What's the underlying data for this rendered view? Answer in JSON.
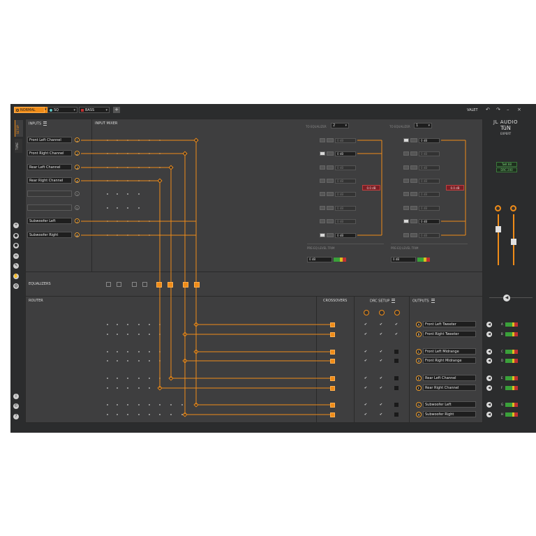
{
  "toolbar": {
    "preset1": "NORMAL",
    "preset2": "SQ",
    "preset3": "BASS",
    "add_icon": "plus-icon",
    "valet": "VALET",
    "undo_icon": "undo-icon",
    "redo_icon": "redo-icon",
    "minimize_icon": "minimize-icon",
    "close_icon": "close-icon"
  },
  "colors": {
    "accent": "#f08c18",
    "panel": "#3e3e3f",
    "bg": "#2b2c2d",
    "red": "#7a1f25"
  },
  "sidebar": {
    "tabs": [
      "SETUP",
      "TUNE"
    ],
    "icons": [
      "plus-circle-icon",
      "user-icon",
      "user-alt-icon",
      "link-icon",
      "wrench-icon",
      "hand-icon",
      "globe-icon"
    ],
    "bottom_icons": [
      "info-icon",
      "copyright-icon",
      "help-icon"
    ]
  },
  "inputs": {
    "title": "INPUTS",
    "items": [
      {
        "label": "Front Left Channel",
        "num": "1"
      },
      {
        "label": "Front Right Channel",
        "num": "2"
      },
      {
        "label": "Rear Left Channel",
        "num": "3"
      },
      {
        "label": "Rear Right Channel",
        "num": "4"
      },
      {
        "label": "",
        "num": "5"
      },
      {
        "label": "",
        "num": "6"
      },
      {
        "label": "Subwoofer Left",
        "num": "7"
      },
      {
        "label": "Subwoofer Right",
        "num": "8"
      }
    ]
  },
  "mixer": {
    "title": "INPUT MIXER",
    "to_eq_label": "TO EQUALIZER",
    "eq1_select": "2",
    "eq2_select": "1",
    "col1_values": [
      "0 dB",
      "0 dB",
      "0 dB",
      "0 dB",
      "0 dB",
      "0 dB",
      "0 dB",
      "0 dB"
    ],
    "col2_values": [
      "0 dB",
      "0 dB",
      "0 dB",
      "0 dB",
      "0 dB",
      "0 dB",
      "0 dB",
      "0 dB"
    ],
    "sum1": "0.0 dB",
    "sum2": "0.0 dB",
    "trim1_label": "PRE-EQ LEVEL TRIM",
    "trim2_label": "PRE-EQ LEVEL TRIM",
    "trim1_value": "0 dB",
    "trim2_value": "0 dB"
  },
  "equalizers": {
    "title": "EQUALIZERS"
  },
  "router": {
    "title": "ROUTER"
  },
  "crossovers": {
    "title": "CROSSOVERS"
  },
  "drc": {
    "title": "DRC SETUP"
  },
  "outputs": {
    "title": "OUTPUTS",
    "items": [
      {
        "letter": "A",
        "label": "Front Left Tweeter"
      },
      {
        "letter": "B",
        "label": "Front Right Tweeter"
      },
      {
        "letter": "C",
        "label": "Front Left Midrange"
      },
      {
        "letter": "D",
        "label": "Front Right Midrange"
      },
      {
        "letter": "E",
        "label": "Rear Left Channel"
      },
      {
        "letter": "F",
        "label": "Rear Right Channel"
      },
      {
        "letter": "G",
        "label": "Subwoofer Left"
      },
      {
        "letter": "H",
        "label": "Subwoofer Right"
      }
    ]
  },
  "brand": {
    "line1": "JL AUDIO",
    "line2": "TüN",
    "line3": "EXPERT",
    "badge1": "TwK 88",
    "badge2": "DRC 200"
  },
  "volume_icon": "speaker-icon"
}
